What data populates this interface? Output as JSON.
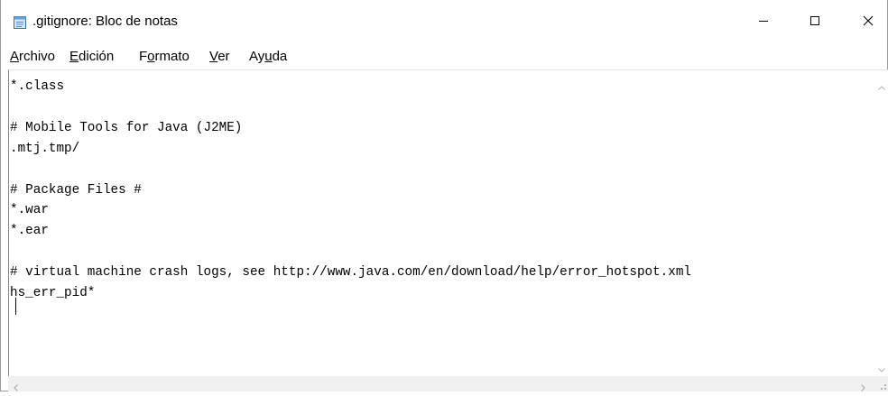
{
  "window": {
    "title": ".gitignore: Bloc de notas",
    "app_icon": "notepad-icon",
    "controls": {
      "minimize": "minimize-icon",
      "maximize": "maximize-icon",
      "close": "close-icon"
    }
  },
  "menu": {
    "items": [
      {
        "accel": "A",
        "rest": "rchivo"
      },
      {
        "accel": "E",
        "rest": "dición"
      },
      {
        "pre": "F",
        "accel": "o",
        "rest": "rmato"
      },
      {
        "accel": "V",
        "rest": "er"
      },
      {
        "pre": "Ay",
        "accel": "u",
        "rest": "da"
      }
    ]
  },
  "editor": {
    "content": "*.class\n\n# Mobile Tools for Java (J2ME)\n.mtj.tmp/\n\n# Package Files #\n*.war\n*.ear\n\n# virtual machine crash logs, see http://www.java.com/en/download/help/error_hotspot.xml\nhs_err_pid*\n"
  },
  "colors": {
    "border": "#828790",
    "scroll_track": "#f0f0f0",
    "arrow": "#a3a3a3"
  }
}
